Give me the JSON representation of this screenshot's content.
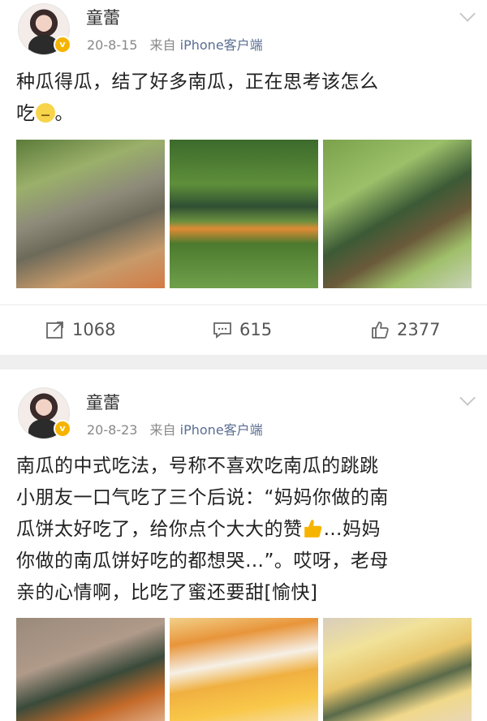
{
  "posts": [
    {
      "author": "童蕾",
      "verified_badge": "v",
      "date": "20-8-15",
      "source_prefix": "来自",
      "source_client": "iPhone客户端",
      "text_line1": "种瓜得瓜，结了好多南瓜，正在思考该怎么",
      "text_line2_a": "吃",
      "text_line2_b": "。",
      "photos": [
        "ph1",
        "ph2",
        "ph3"
      ],
      "repost_count": "1068",
      "comment_count": "615",
      "like_count": "2377"
    },
    {
      "author": "童蕾",
      "verified_badge": "v",
      "date": "20-8-23",
      "source_prefix": "来自",
      "source_client": "iPhone客户端",
      "text_line1": "南瓜的中式吃法，号称不喜欢吃南瓜的跳跳",
      "text_line2": "小朋友一口气吃了三个后说：“妈妈你做的南",
      "text_line3_a": "瓜饼太好吃了，给你点个大大的赞",
      "text_line3_b": "…妈妈",
      "text_line4": "你做的南瓜饼好吃的都想哭…”。哎呀，老母",
      "text_line5": "亲的心情啊，比吃了蜜还要甜[愉快]",
      "photos": [
        "ph4",
        "ph5",
        "ph6"
      ]
    }
  ],
  "colors": {
    "link": "#5b6e92",
    "meta": "#888888",
    "separator": "#efefef",
    "badge": "#f6b400"
  }
}
